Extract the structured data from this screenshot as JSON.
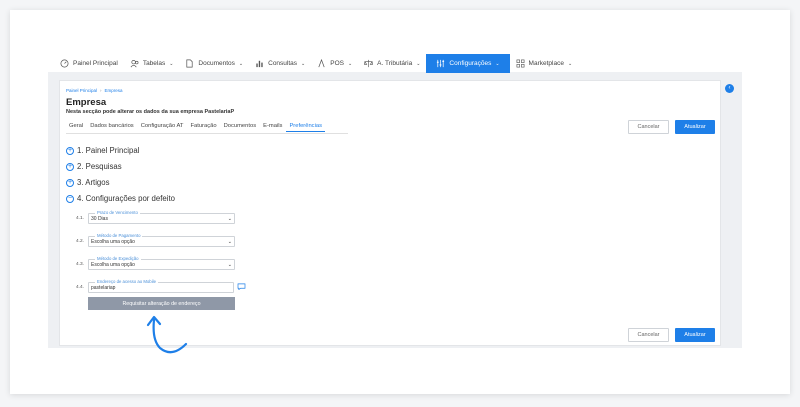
{
  "nav": {
    "items": [
      {
        "label": "Painel Principal",
        "icon": "gauge-icon",
        "chevron": false,
        "active": false
      },
      {
        "label": "Tabelas",
        "icon": "users-icon",
        "chevron": true,
        "active": false
      },
      {
        "label": "Documentos",
        "icon": "document-icon",
        "chevron": true,
        "active": false
      },
      {
        "label": "Consultas",
        "icon": "bar-chart-icon",
        "chevron": true,
        "active": false
      },
      {
        "label": "POS",
        "icon": "pos-icon",
        "chevron": true,
        "active": false
      },
      {
        "label": "A. Tributária",
        "icon": "scale-icon",
        "chevron": true,
        "active": false
      },
      {
        "label": "Configurações",
        "icon": "sliders-icon",
        "chevron": true,
        "active": true
      },
      {
        "label": "Marketplace",
        "icon": "grid-icon",
        "chevron": true,
        "active": false
      }
    ],
    "chevron_glyph": "⌄"
  },
  "breadcrumb": {
    "home": "Painel Principal",
    "separator": "›",
    "current": "Empresa"
  },
  "page": {
    "title": "Empresa",
    "subtitle": "Nesta secção pode alterar os dados da sua empresa PastelariaP"
  },
  "tabs": [
    "Geral",
    "Dados bancários",
    "Configuração AT",
    "Faturação",
    "Documentos",
    "E-mails",
    "Preferências"
  ],
  "active_tab": "Preferências",
  "buttons": {
    "cancel": "Cancelar",
    "update": "Atualizar",
    "request": "Requisitar alteração de endereço"
  },
  "sections": [
    {
      "label": "1. Painel Principal",
      "toggle": "+"
    },
    {
      "label": "2. Pesquisas",
      "toggle": "+"
    },
    {
      "label": "3. Artigos",
      "toggle": "+"
    },
    {
      "label": "4. Configurações por defeito",
      "toggle": "−"
    }
  ],
  "fields": [
    {
      "num": "4.1.",
      "legend": "Prazo de Vencimento",
      "value": "30 Dias",
      "type": "select"
    },
    {
      "num": "4.2.",
      "legend": "Método de Pagamento",
      "value": "Escolha uma opção",
      "type": "select"
    },
    {
      "num": "4.3.",
      "legend": "Método de Expedição",
      "value": "Escolha uma opção",
      "type": "select"
    },
    {
      "num": "4.4.",
      "legend": "Endereço de acesso ao Mobile",
      "value": "pastelariap",
      "type": "text"
    }
  ],
  "caret_glyph": "⌄",
  "colors": {
    "accent": "#1e7fe8",
    "request_button": "#8f98a7"
  }
}
